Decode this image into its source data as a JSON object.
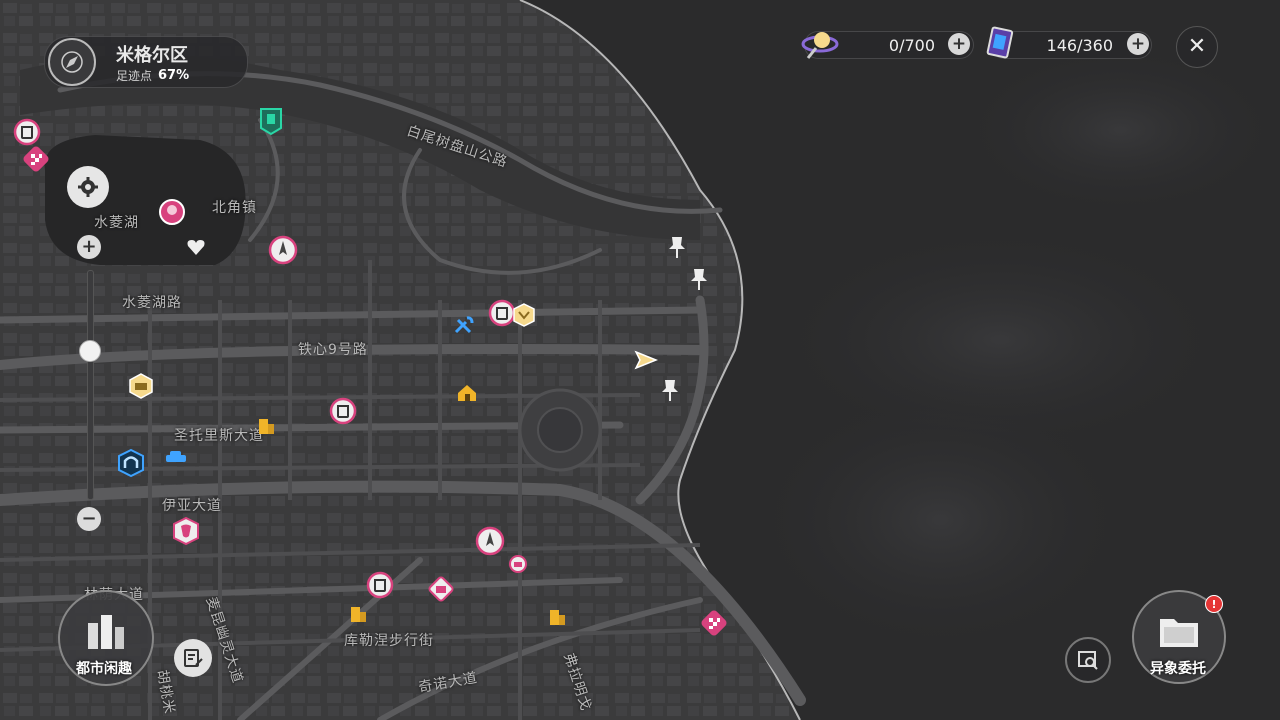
{
  "district": {
    "name": "米格尔区",
    "footprint_label": "足迹点",
    "footprint_pct": "67%"
  },
  "currency": [
    {
      "icon": "lollipop-icon",
      "value": "0/700"
    },
    {
      "icon": "card-icon",
      "value": "146/360"
    }
  ],
  "streets": [
    "白尾树盘山公路",
    "水菱湖",
    "北角镇",
    "水菱湖路",
    "铁心9号路",
    "圣托里斯大道",
    "伊亚大道",
    "库勒涅步行街",
    "奇诺大道",
    "麦昆幽灵大道",
    "胡桃米",
    "弗拉明戈",
    "林荫大道"
  ],
  "buttons": {
    "city_fun": "都市闲趣",
    "anomaly": "异象委托"
  },
  "zoom_level": 0.35,
  "colors": {
    "map_road": "#555557",
    "map_land": "#3a3a3b",
    "water": "#2d2d2e",
    "marker_pink": "#d8427e",
    "marker_yellow": "#f0b429",
    "marker_blue": "#3fa3ff",
    "marker_teal": "#2ad6a6",
    "badge_red": "#e53535"
  }
}
